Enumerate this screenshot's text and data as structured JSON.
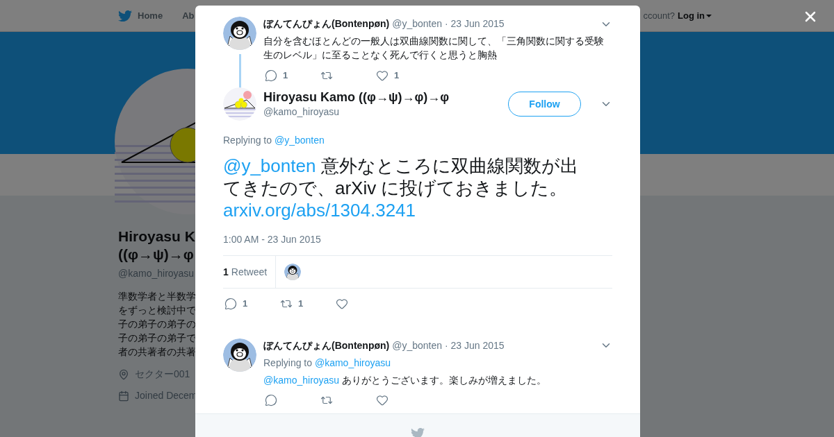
{
  "nav": {
    "items": [
      {
        "label": "Home",
        "kind": "home"
      },
      {
        "label": "Ab",
        "kind": "plain"
      }
    ],
    "account_prompt": "ccount?",
    "login": "Log in"
  },
  "profile": {
    "name_lines": [
      "Hiroyasu K",
      "((φ→ψ)→φ"
    ],
    "handle": "@kamo_hiroyasu",
    "bio_lines": [
      "準数学者と半数学",
      "をずっと検討中で",
      "子の弟子の弟子の",
      "子の弟子の弟子で",
      "者の共著者の共著"
    ],
    "location": "セクター001",
    "joined": "Joined Decem"
  },
  "modal": {
    "parent_tweet": {
      "name": "ぼんてんぴょん(Bontenpøn)",
      "handle": "@y_bonten",
      "date": "· 23 Jun 2015",
      "text": "自分を含むほとんどの一般人は双曲線関数に関して、「三角関数に関する受験生のレベル」に至ることなく死んで行くと思うと胸熱",
      "actions": [
        {
          "kind": "reply",
          "count": "1"
        },
        {
          "kind": "retweet"
        },
        {
          "kind": "like",
          "count": "1"
        }
      ]
    },
    "main_tweet": {
      "name": "Hiroyasu Kamo ((φ→ψ)→φ)→φ",
      "handle": "@kamo_hiroyasu",
      "follow": "Follow",
      "replying_prefix": "Replying to",
      "replying_to": "@y_bonten",
      "mention": "@y_bonten",
      "text": "意外なところに双曲線関数が出てきたので、arXiv に投げておきました。",
      "link": "arxiv.org/abs/1304.3241",
      "timestamp": "1:00 AM - 23 Jun 2015",
      "retweet_count": "1",
      "retweet_label": "Retweet",
      "actions": [
        {
          "kind": "reply",
          "count": "1"
        },
        {
          "kind": "retweet",
          "count": "1"
        },
        {
          "kind": "like"
        }
      ]
    },
    "replies": [
      {
        "name": "ぼんてんぴょん(Bontenpøn)",
        "handle": "@y_bonten",
        "date": "· 23 Jun 2015",
        "replying_prefix": "Replying to",
        "replying_to": "@kamo_hiroyasu",
        "mention": "@kamo_hiroyasu",
        "text": "ありがとうございます。楽しみが増えました。",
        "actions": [
          {
            "kind": "reply"
          },
          {
            "kind": "retweet"
          },
          {
            "kind": "like"
          }
        ]
      }
    ]
  }
}
